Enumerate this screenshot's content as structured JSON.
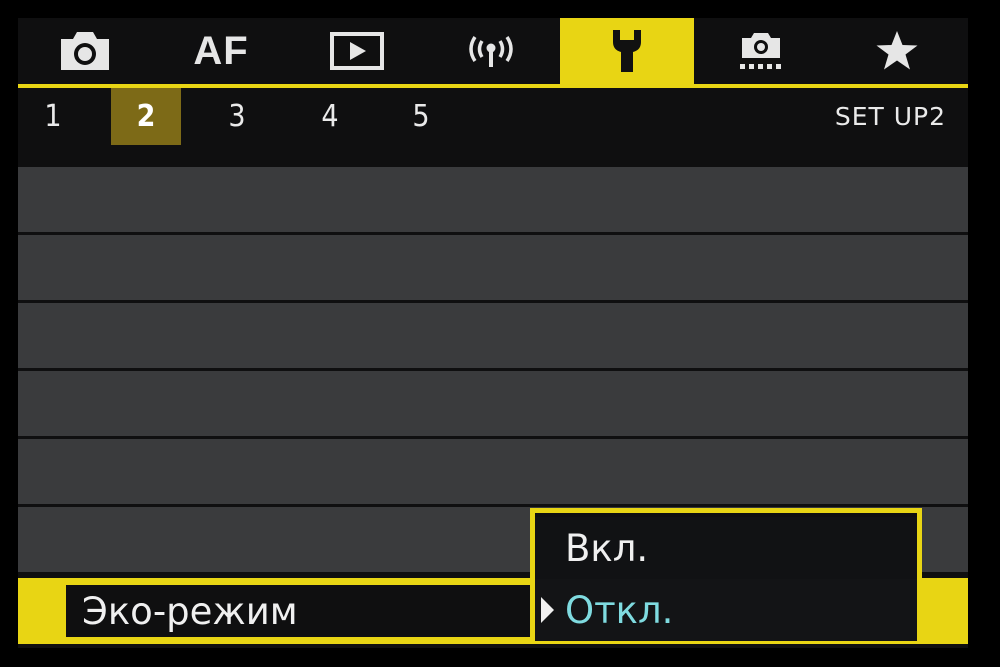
{
  "tabs": [
    {
      "name": "camera-icon",
      "active": false
    },
    {
      "name": "af-tab",
      "label": "AF",
      "active": false
    },
    {
      "name": "playback-icon",
      "active": false
    },
    {
      "name": "wireless-icon",
      "active": false
    },
    {
      "name": "wrench-icon",
      "active": true
    },
    {
      "name": "custom-function-icon",
      "active": false
    },
    {
      "name": "star-icon",
      "active": false
    }
  ],
  "pages": [
    "1",
    "2",
    "3",
    "4",
    "5"
  ],
  "active_page": "2",
  "menu_title": "SET UP2",
  "selected_item": {
    "label": "Эко-режим"
  },
  "popup": {
    "options": [
      "Вкл.",
      "Откл."
    ],
    "current": "Откл."
  },
  "colors": {
    "accent": "#e8d514",
    "row_bg": "#3a3b3d",
    "selected_value": "#7fdbe0"
  }
}
